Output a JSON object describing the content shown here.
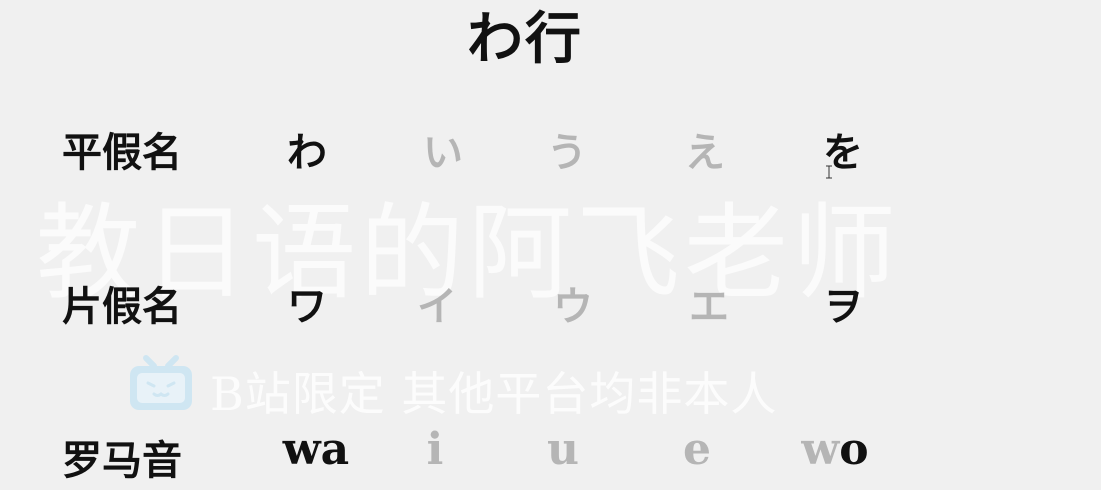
{
  "title": "わ行",
  "watermark": {
    "main_text": "教日语的阿飞老师",
    "sub_text": "B站限定 其他平台均非本人",
    "logo_icon": "bilibili-tv-icon",
    "logo_color": "#cfe6f2"
  },
  "colors": {
    "active": "#111111",
    "inactive": "#b5b5b5",
    "background": "#f0f0f0"
  },
  "rows": {
    "hiragana": {
      "label": "平假名",
      "cells": [
        "わ",
        "い",
        "う",
        "え",
        "を"
      ]
    },
    "katakana": {
      "label": "片假名",
      "cells": [
        "ワ",
        "イ",
        "ウ",
        "エ",
        "ヲ"
      ]
    },
    "romaji": {
      "label": "罗马音",
      "cells": [
        [
          "wa",
          ""
        ],
        [
          "",
          "i"
        ],
        [
          "",
          "u"
        ],
        [
          "",
          "e"
        ],
        [
          "o",
          "w"
        ]
      ]
    }
  },
  "active_columns": [
    0,
    4
  ]
}
